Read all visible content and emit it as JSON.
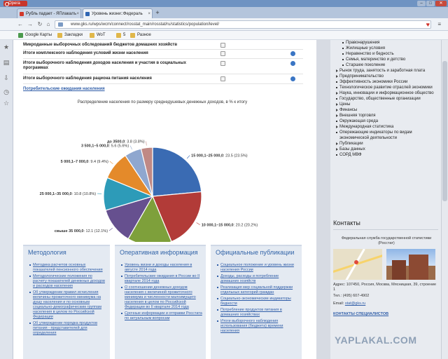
{
  "browser": {
    "app_name": "Opera",
    "tabs": [
      {
        "label": "Рубль падает - ЯПлакалъ"
      },
      {
        "label": "Уровень жизни::Федераль"
      }
    ],
    "url": "www.gks.ru/wps/wcm/connect/rosstat_main/rosstat/ru/statistics/population/level/",
    "bookmarks": [
      {
        "label": "Google Карты"
      },
      {
        "label": "Закладки"
      },
      {
        "label": "WoT"
      },
      {
        "label": "5"
      },
      {
        "label": "Разное"
      }
    ]
  },
  "surveys": [
    {
      "label": "Микроданные выборочных обследований бюджетов домашних хозяйств"
    },
    {
      "label": "Итоги комплексного наблюдения условий жизни населения"
    },
    {
      "label": "Итоги выборочного наблюдения доходов населения и участия в социальных программах"
    },
    {
      "label": "Итоги выборочного наблюдения рациона питания населения"
    }
  ],
  "expectations_link": "Потребительские ожидания населения",
  "chart_data": {
    "type": "pie",
    "title": "Распределение населения по размеру среднедушевых денежных доходов, в % к итогу",
    "slices": [
      {
        "label": "15 000,1–25 000,0",
        "value": 23.5,
        "display": "23.5 (23.5%)",
        "color": "#3a6bb3"
      },
      {
        "label": "10 000,1–15 000,0",
        "value": 20.2,
        "display": "20.2 (20.2%)",
        "color": "#b23b38"
      },
      {
        "label": "7 000,1–10 000,0",
        "value": 14.6,
        "display": "14.6 (14.6%)",
        "color": "#7ea03b"
      },
      {
        "label": "свыше 35 000,0",
        "value": 12.1,
        "display": "12.1 (12.1%)",
        "color": "#66508f"
      },
      {
        "label": "25 000,1–35 000,0",
        "value": 10.8,
        "display": "10.8 (10.8%)",
        "color": "#2d9bb8"
      },
      {
        "label": "5 000,1–7 000,0",
        "value": 9.4,
        "display": "9.4 (9.4%)",
        "color": "#e48a2a"
      },
      {
        "label": "3 500,1–5 000,0",
        "value": 5.6,
        "display": "5.6 (5.6%)",
        "color": "#8fa7cf"
      },
      {
        "label": "до 3500,0",
        "value": 3.8,
        "display": "3.8 (3.8%)",
        "color": "#c08985"
      }
    ]
  },
  "panels": [
    {
      "title": "Методология",
      "items": [
        "Методика расчетов основных показателей пенсионного обеспечения",
        "Методологические положения по расчету показателей денежных доходов и расходов населения",
        "Об утверждении правил исчисления величины прожиточного минимума на душу населения и по основным социально-демографическим группам населения в целом по Российской Федерации",
        "Об утверждении порядка продуктов питания - представителей для определения"
      ]
    },
    {
      "title": "Оперативная информация",
      "items": [
        "Уровень жизни и доходы населения в августе 2014 года",
        "Потребительские ожидания в России во II квартале 2014 года",
        "О соотношении денежных доходов населения с величиной прожиточного минимума и численности малоимущего населения в целом по Российской Федерации во II квартале 2014 года",
        "Срочные информации и отправки Росстата по актуальным вопросам"
      ]
    },
    {
      "title": "Официальные публикации",
      "items": [
        "Социальное положение и уровень жизни населения России",
        "Доходы, расходы и потребление домашних хозяйств",
        "Реализация мер социальной поддержки отдельных категорий граждан",
        "Социально-экономические индикаторы бедности",
        "Потребление продуктов питания в домашних хозяйствах",
        "Итоги выборочного наблюдения использования (бюджета) времени населения"
      ]
    }
  ],
  "right_nav": [
    {
      "label": "Правонарушения",
      "level": "sub"
    },
    {
      "label": "Жилищные условия",
      "level": "sub"
    },
    {
      "label": "Неравенство и бедность",
      "level": "sub"
    },
    {
      "label": "Семья, материнство и детство",
      "level": "sub"
    },
    {
      "label": "Старшее поколение",
      "level": "sub"
    },
    {
      "label": "Рынок труда, занятость и заработная плата",
      "level": "arr"
    },
    {
      "label": "Предпринимательство",
      "level": "arr"
    },
    {
      "label": "Эффективность экономики России",
      "level": "top"
    },
    {
      "label": "Технологическое развитие отраслей экономики",
      "level": "top"
    },
    {
      "label": "Наука, инновации и информационное общество",
      "level": "arr"
    },
    {
      "label": "Государство, общественные организации",
      "level": "top"
    },
    {
      "label": "Цены",
      "level": "arr"
    },
    {
      "label": "Финансы",
      "level": "arr"
    },
    {
      "label": "Внешняя торговля",
      "level": "arr"
    },
    {
      "label": "Окружающая среда",
      "level": "top"
    },
    {
      "label": "Международная статистика",
      "level": "arr"
    },
    {
      "label": "Опережающие индикаторы по видам экономической деятельности",
      "level": "top"
    },
    {
      "label": "Публикации",
      "level": "arr"
    },
    {
      "label": "Базы данных",
      "level": "arr"
    },
    {
      "label": "СОРД МВФ",
      "level": "top"
    }
  ],
  "contacts": {
    "title": "Контакты",
    "org": "Федеральная служба государственной статистики (Росстат)",
    "address": "Адрес: 107450, Россия, Москва, Мясницкая, 39, строение 1",
    "phone": "Тел.: (495) 607-4902",
    "email_label": "Email:",
    "email": "stat@gks.ru",
    "specialists": "КОНТАКТЫ СПЕЦИАЛИСТОВ"
  },
  "watermark": "YAPLAKAL.COM"
}
